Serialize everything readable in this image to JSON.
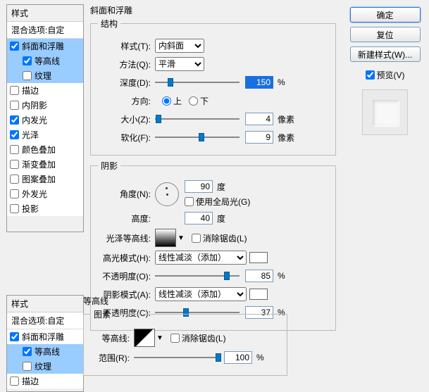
{
  "styles1": {
    "header": "样式",
    "blend": "混合选项:自定",
    "items": [
      {
        "label": "斜面和浮雕",
        "checked": true,
        "selected": true
      },
      {
        "label": "等高线",
        "checked": true,
        "selected": true,
        "sub": true
      },
      {
        "label": "纹理",
        "checked": false,
        "selected": true,
        "sub": true
      },
      {
        "label": "描边",
        "checked": false
      },
      {
        "label": "内阴影",
        "checked": false
      },
      {
        "label": "内发光",
        "checked": true
      },
      {
        "label": "光泽",
        "checked": true
      },
      {
        "label": "颜色叠加",
        "checked": false
      },
      {
        "label": "渐变叠加",
        "checked": false
      },
      {
        "label": "图案叠加",
        "checked": false
      },
      {
        "label": "外发光",
        "checked": false
      },
      {
        "label": "投影",
        "checked": false
      }
    ]
  },
  "styles2": {
    "header": "样式",
    "blend": "混合选项:自定",
    "items": [
      {
        "label": "斜面和浮雕",
        "checked": true,
        "selected": false
      },
      {
        "label": "等高线",
        "checked": true,
        "selected": true,
        "sub": true
      },
      {
        "label": "纹理",
        "checked": false,
        "selected": true,
        "sub": true
      },
      {
        "label": "描边",
        "checked": false
      }
    ]
  },
  "buttons": {
    "ok": "确定",
    "reset": "复位",
    "newstyle": "新建样式(W)...",
    "preview": "预览(V)"
  },
  "bevel": {
    "title": "斜面和浮雕",
    "struct_title": "结构",
    "style_lbl": "样式(T):",
    "style_val": "内斜面",
    "method_lbl": "方法(Q):",
    "method_val": "平滑",
    "depth_lbl": "深度(D):",
    "depth_val": "150",
    "depth_unit": "%",
    "dir_lbl": "方向:",
    "dir_up": "上",
    "dir_down": "下",
    "size_lbl": "大小(Z):",
    "size_val": "4",
    "size_unit": "像素",
    "soften_lbl": "软化(F):",
    "soften_val": "9",
    "soften_unit": "像素",
    "shade_title": "阴影",
    "angle_lbl": "角度(N):",
    "angle_val": "90",
    "angle_unit": "度",
    "global": "使用全局光(G)",
    "alt_lbl": "高度:",
    "alt_val": "40",
    "alt_unit": "度",
    "gloss_lbl": "光泽等高线:",
    "aa": "消除锯齿(L)",
    "hi_mode_lbl": "高光模式(H):",
    "hi_mode_val": "线性减淡（添加）",
    "hi_op_lbl": "不透明度(O):",
    "hi_op_val": "85",
    "op_unit": "%",
    "sh_mode_lbl": "阴影模式(A):",
    "sh_mode_val": "线性减淡（添加）",
    "sh_op_lbl": "不透明度(C):",
    "sh_op_val": "37"
  },
  "contour": {
    "title": "等高线",
    "elem_title": "图素",
    "contour_lbl": "等高线:",
    "aa": "消除锯齿(L)",
    "range_lbl": "范围(R):",
    "range_val": "100",
    "unit": "%"
  }
}
